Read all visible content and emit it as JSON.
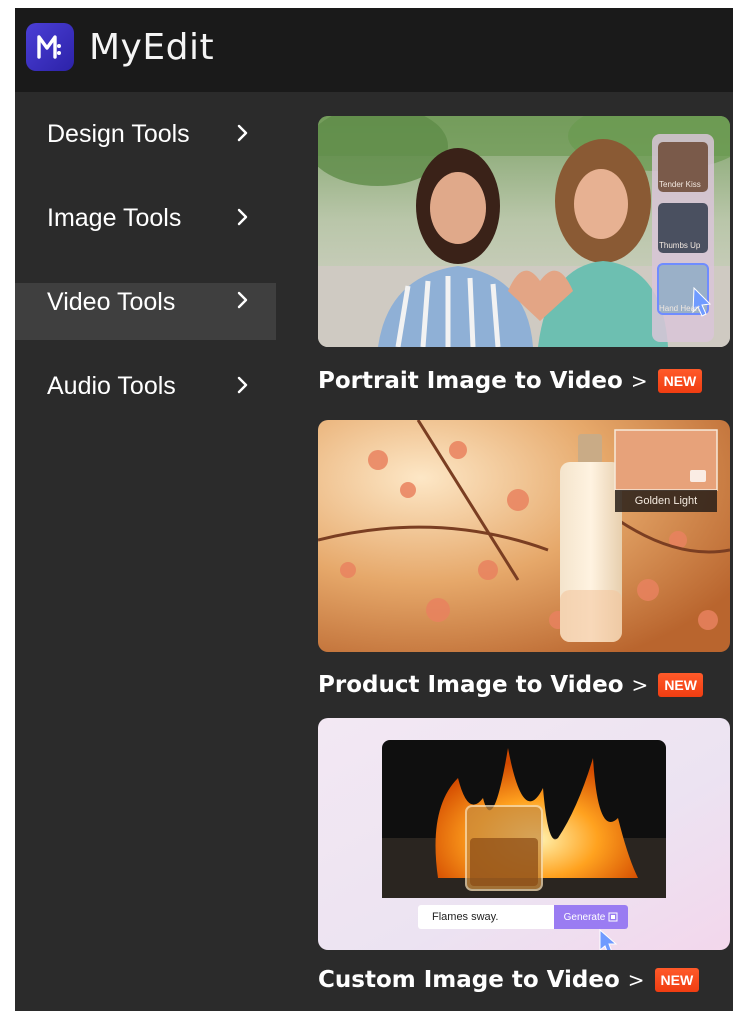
{
  "header": {
    "brand": "MyEdit",
    "logo_icon": "myedit-logo-icon",
    "accent": "#3b30c4"
  },
  "sidebar": {
    "items": [
      {
        "label": "Design Tools",
        "active": false
      },
      {
        "label": "Image Tools",
        "active": false
      },
      {
        "label": "Video Tools",
        "active": true
      },
      {
        "label": "Audio Tools",
        "active": false
      }
    ]
  },
  "cards": [
    {
      "title": "Portrait Image to Video",
      "arrow": ">",
      "badge": "NEW",
      "thumbs": [
        "Tender Kiss",
        "Thumbs Up",
        "Hand Heart"
      ]
    },
    {
      "title": "Product Image to Video",
      "arrow": ">",
      "badge": "NEW",
      "preset": "Golden Light"
    },
    {
      "title": "Custom Image to Video",
      "arrow": ">",
      "badge": "NEW",
      "prompt": "Flames sway.",
      "generate": "Generate"
    }
  ],
  "colors": {
    "panel": "#2b2b2b",
    "header": "#1a1a1a",
    "active_item": "#3f3f3f",
    "badge": "#f03d12",
    "generate": "#9a7cf2"
  }
}
